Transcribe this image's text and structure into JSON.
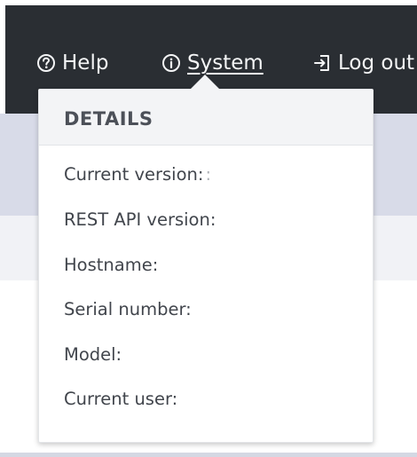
{
  "nav": {
    "help_label": "Help",
    "system_label": "System",
    "logout_label": "Log out"
  },
  "details": {
    "title": "DETAILS",
    "rows": [
      {
        "label": "Current version:",
        "value": ":"
      },
      {
        "label": "REST API version:",
        "value": ""
      },
      {
        "label": "Hostname:",
        "value": ""
      },
      {
        "label": "Serial number:",
        "value": ""
      },
      {
        "label": "Model:",
        "value": ""
      },
      {
        "label": "Current user:",
        "value": ""
      }
    ]
  },
  "colors": {
    "top_bar": "#2a2e33",
    "nav_text": "#f4f5f6",
    "popover_header": "#f3f4f6",
    "title_text": "#4c5058",
    "row_text": "#41454c"
  },
  "icons": {
    "help": "question-circle-icon",
    "system": "info-circle-icon",
    "logout": "logout-arrow-icon"
  }
}
